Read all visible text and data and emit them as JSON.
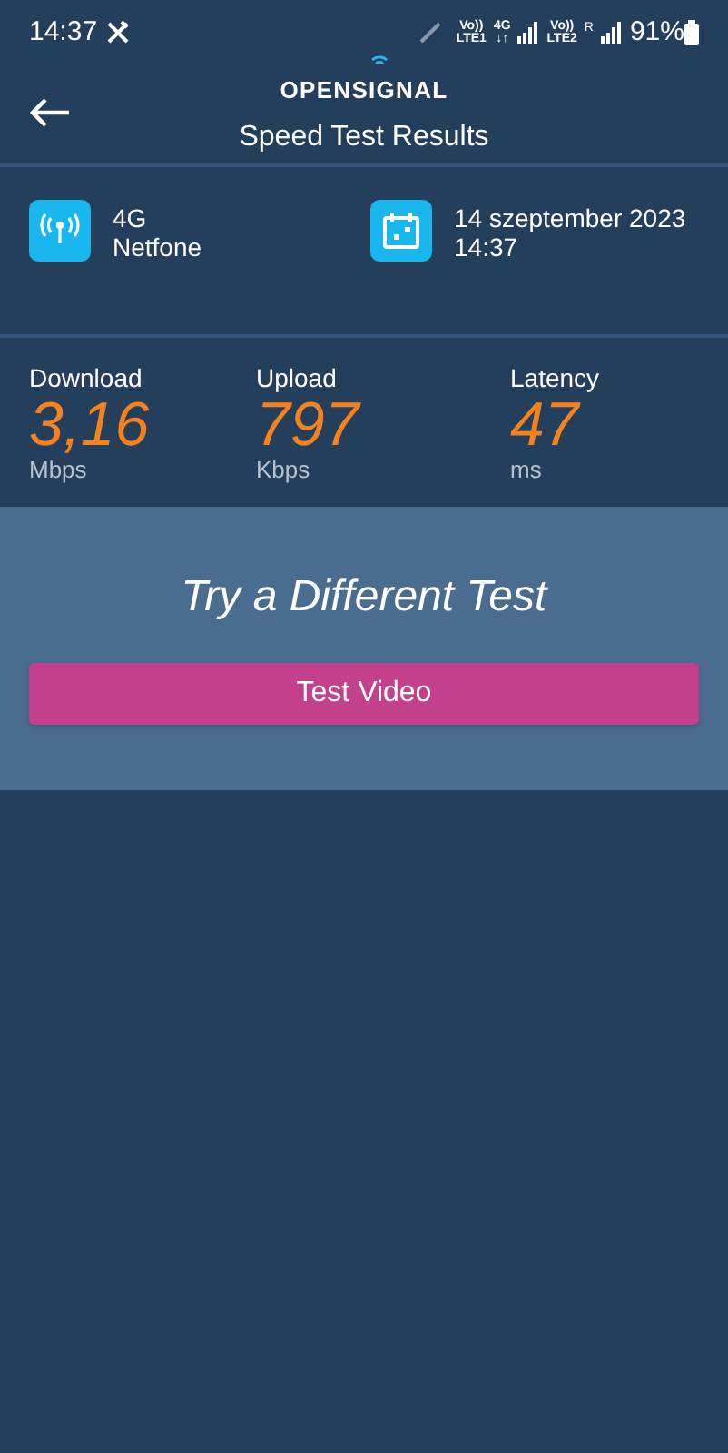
{
  "status_bar": {
    "time": "14:37",
    "indicators": [
      {
        "top": "Vo))",
        "bottom": "LTE1"
      },
      {
        "top": "4G",
        "bottom": "↓↑"
      },
      {
        "top": "Vo))",
        "bottom": "LTE2"
      }
    ],
    "roaming": "R",
    "battery": "91%"
  },
  "header": {
    "logo": "OPENSIGNAL",
    "title": "Speed Test Results"
  },
  "info": [
    {
      "kind": "network",
      "line1": "4G",
      "line2": "Netfone"
    },
    {
      "kind": "date",
      "line1": "14 szeptember 2023",
      "line2": "14:37"
    }
  ],
  "metrics": [
    {
      "label": "Download",
      "value": "3,16",
      "unit": "Mbps"
    },
    {
      "label": "Upload",
      "value": "797",
      "unit": "Kbps"
    },
    {
      "label": "Latency",
      "value": "47",
      "unit": "ms"
    }
  ],
  "promo": {
    "title": "Try a Different Test",
    "button": "Test Video"
  }
}
